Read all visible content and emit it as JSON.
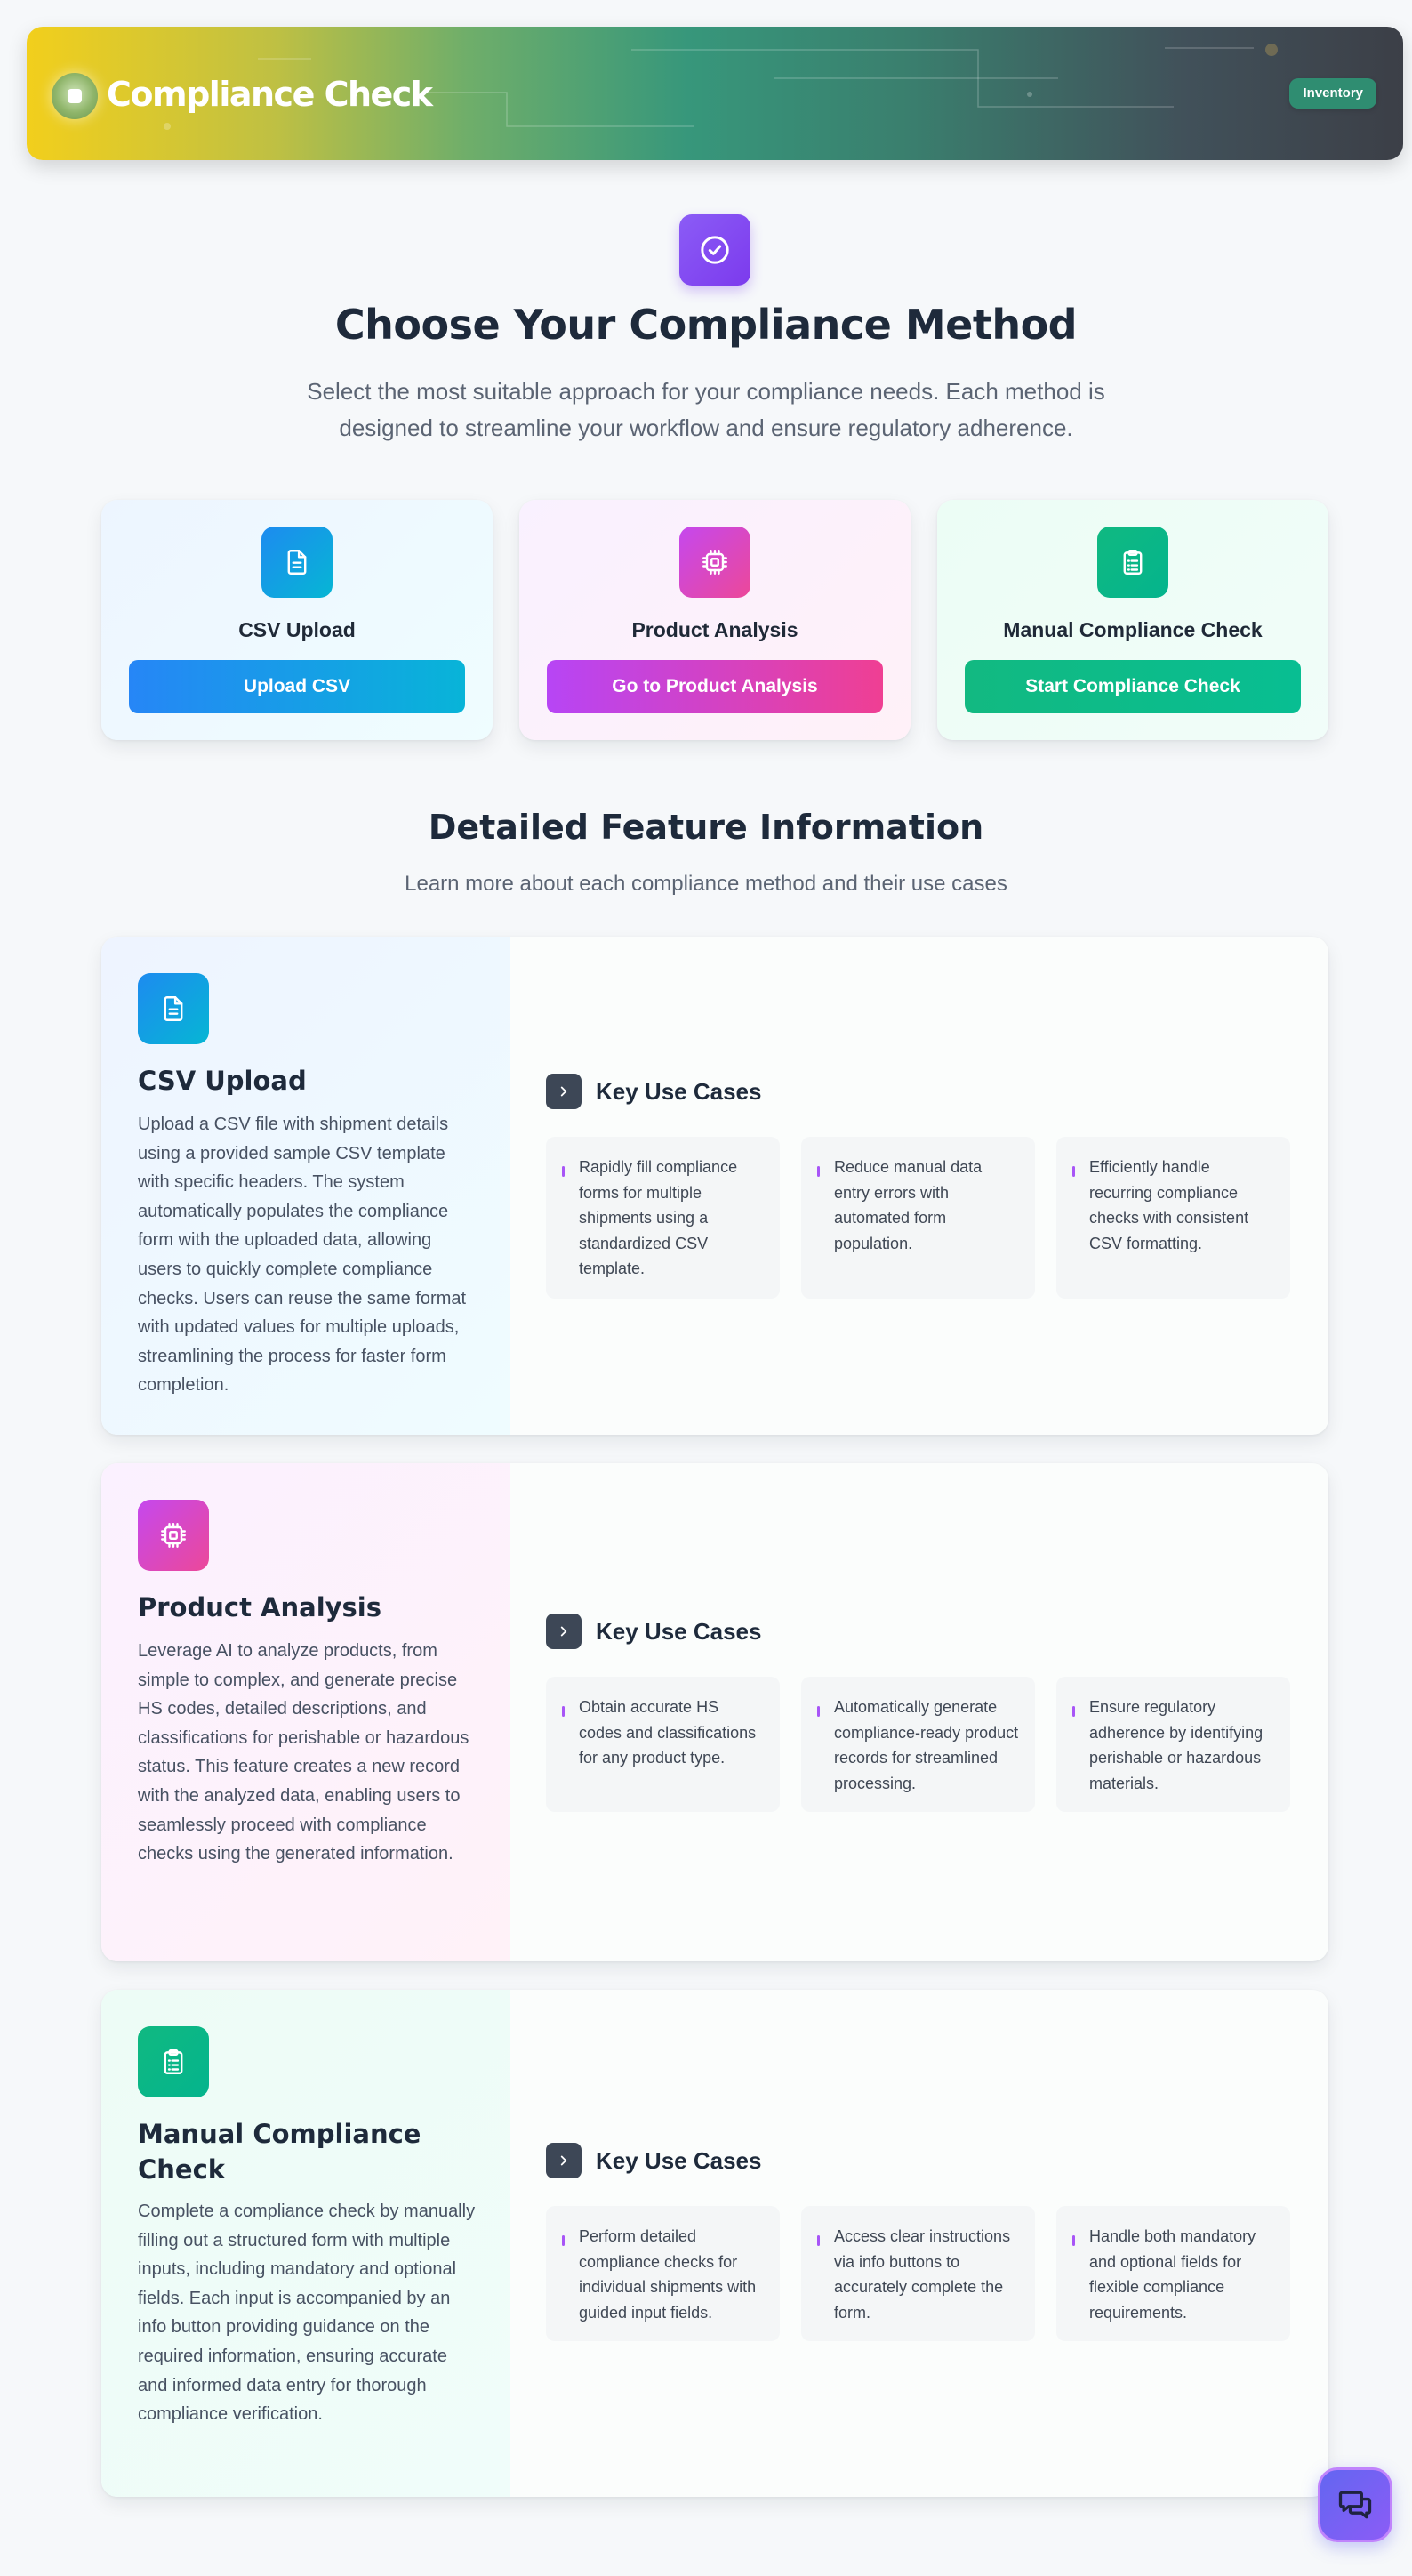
{
  "header": {
    "title": "Compliance Check",
    "badge": "Inventory"
  },
  "hero": {
    "title": "Choose Your Compliance Method",
    "subtitle": "Select the most suitable approach for your compliance needs. Each method is designed to streamline your workflow and ensure regulatory adherence."
  },
  "methods": [
    {
      "title": "CSV Upload",
      "button": "Upload CSV",
      "icon": "document-icon"
    },
    {
      "title": "Product Analysis",
      "button": "Go to Product Analysis",
      "icon": "cpu-chip-icon"
    },
    {
      "title": "Manual Compliance Check",
      "button": "Start Compliance Check",
      "icon": "clipboard-icon"
    }
  ],
  "details": {
    "title": "Detailed Feature Information",
    "subtitle": "Learn more about each compliance method and their use cases",
    "use_cases_label": "Key Use Cases",
    "features": [
      {
        "title": "CSV Upload",
        "description": "Upload a CSV file with shipment details using a provided sample CSV template with specific headers. The system automatically populates the compliance form with the uploaded data, allowing users to quickly complete compliance checks. Users can reuse the same format with updated values for multiple uploads, streamlining the process for faster form completion.",
        "use_cases": [
          "Rapidly fill compliance forms for multiple shipments using a standardized CSV template.",
          "Reduce manual data entry errors with automated form population.",
          "Efficiently handle recurring compliance checks with consistent CSV formatting."
        ]
      },
      {
        "title": "Product Analysis",
        "description": "Leverage AI to analyze products, from simple to complex, and generate precise HS codes, detailed descriptions, and classifications for perishable or hazardous status. This feature creates a new record with the analyzed data, enabling users to seamlessly proceed with compliance checks using the generated information.",
        "use_cases": [
          "Obtain accurate HS codes and classifications for any product type.",
          "Automatically generate compliance-ready product records for streamlined processing.",
          "Ensure regulatory adherence by identifying perishable or hazardous materials."
        ]
      },
      {
        "title": "Manual Compliance Check",
        "description": "Complete a compliance check by manually filling out a structured form with multiple inputs, including mandatory and optional fields. Each input is accompanied by an info button providing guidance on the required information, ensuring accurate and informed data entry for thorough compliance verification.",
        "use_cases": [
          "Perform detailed compliance checks for individual shipments with guided input fields.",
          "Access clear instructions via info buttons to accurately complete the form.",
          "Handle both mandatory and optional fields for flexible compliance requirements."
        ]
      }
    ]
  },
  "colors": {
    "blue": "#1d8bf0",
    "pink": "#d946ef",
    "green": "#10b981",
    "purple": "#8b5cf6",
    "dark": "#1e2a3b"
  },
  "chat": {
    "icon": "chat-bubbles-icon"
  }
}
